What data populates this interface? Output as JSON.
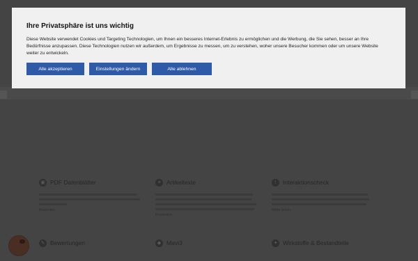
{
  "consent": {
    "title": "Ihre Privatsphäre ist uns wichtig",
    "body": "Diese Website verwendet Cookies und Targeting Technologien, um Ihnen ein besseres Internet-Erlebnis zu ermöglichen und die Werbung, die Sie sehen, besser an Ihre Bedürfnisse anzupassen. Diese Technologien nutzen wir außerdem, um Ergebnisse zu messen, um zu verstehen, woher unsere Besucher kommen oder um unsere Website weiter zu entwickeln.",
    "accept_all": "Alle akzeptieren",
    "settings": "Einstellungen ändern",
    "reject_all": "Alle ablehnen"
  },
  "features": [
    {
      "title": "PDF Datenblätter",
      "icon": "pdf-icon",
      "more": "Beachten"
    },
    {
      "title": "Artikeltexte",
      "icon": "text-icon",
      "more": "Kostenlos"
    },
    {
      "title": "Interaktionscheck",
      "icon": "warning-icon",
      "more": "Mehr lesen"
    },
    {
      "title": "Bewertungen",
      "icon": "comment-icon"
    },
    {
      "title": "Mavi3",
      "icon": "chat-icon"
    },
    {
      "title": "Wirkstoffe & Bestandteile",
      "icon": "tool-icon"
    }
  ],
  "colors": {
    "accent": "#2f5aa8",
    "banner_bg": "#f0f0f0",
    "overlay": "#444444"
  }
}
